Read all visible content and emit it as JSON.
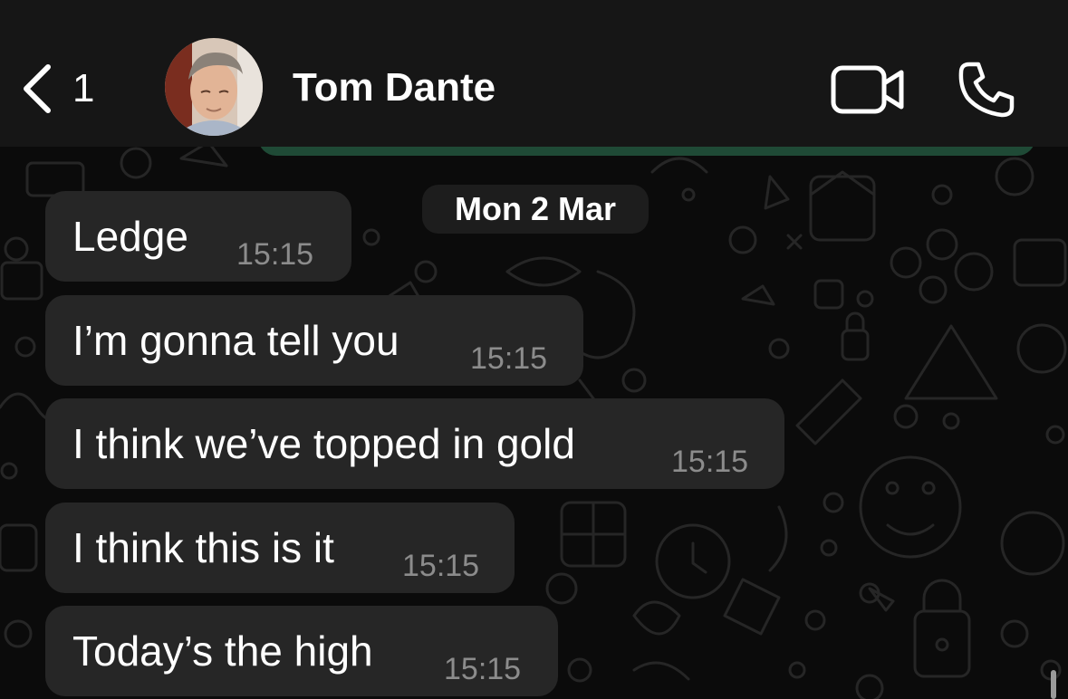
{
  "header": {
    "back_count": "1",
    "contact_name": "Tom Dante",
    "icons": [
      "chevron-left-icon",
      "video-camera-icon",
      "phone-icon"
    ]
  },
  "chat": {
    "date_separator": "Mon 2 Mar",
    "messages": [
      {
        "text": "Ledge",
        "time": "15:15"
      },
      {
        "text": "I’m gonna tell you",
        "time": "15:15"
      },
      {
        "text": "I think we’ve topped in gold",
        "time": "15:15"
      },
      {
        "text": "I think this is it",
        "time": "15:15"
      },
      {
        "text": "Today’s the high",
        "time": "15:15"
      }
    ]
  },
  "colors": {
    "background": "#0b0b0b",
    "header": "#161616",
    "incoming_bubble": "#262626",
    "outgoing_bubble": "#1f4a36",
    "timestamp": "#8c8c8c"
  }
}
